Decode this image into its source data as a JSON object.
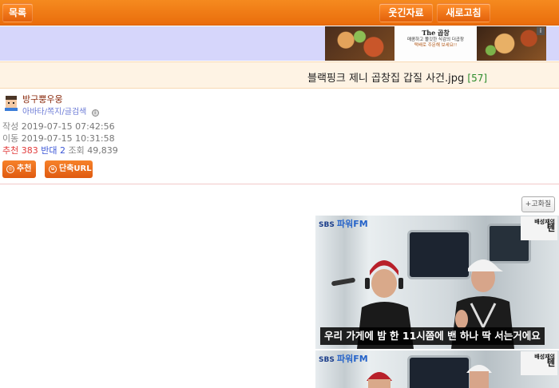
{
  "topbar": {
    "list_label": "목록",
    "humor_label": "웃긴자료",
    "refresh_label": "새로고침"
  },
  "ad": {
    "logo": "The 곱창",
    "line1": "매콤하고 쫄깃한 식감의 더곱창",
    "line2": "택배로 주문해 보세요!!"
  },
  "post": {
    "title": "블랙핑크 제니 곱창집 갑질 사건.jpg",
    "comment_count": "[57]"
  },
  "author": {
    "nickname": "방구뿡우웅",
    "links": [
      "아바타",
      "쪽지",
      "글검색"
    ],
    "separator": "/"
  },
  "meta": {
    "written_label": "작성",
    "written": "2019-07-15 07:42:56",
    "moved_label": "이동",
    "moved": "2019-07-15 10:31:58",
    "recommend_label": "추천",
    "recommend": "383",
    "oppose_label": "반대",
    "oppose": "2",
    "views_label": "조회",
    "views": "49,839"
  },
  "actions": {
    "recommend_btn": "추천",
    "short_url_btn": "단축URL",
    "hq_btn": "+고화질"
  },
  "video": {
    "station": "SBS",
    "station_sub": "파워FM",
    "show_name": "배성재의",
    "show_name2": "텐",
    "caption": "우리 가게에 밤 한 11시쯤에 밴 하나 딱 서는거에요"
  },
  "colors": {
    "topbar": "#f07a17",
    "adstrip": "#d6d6fb",
    "titlebar": "#fef3e4",
    "recommend": "#e23b3b",
    "oppose": "#3a55d6"
  }
}
